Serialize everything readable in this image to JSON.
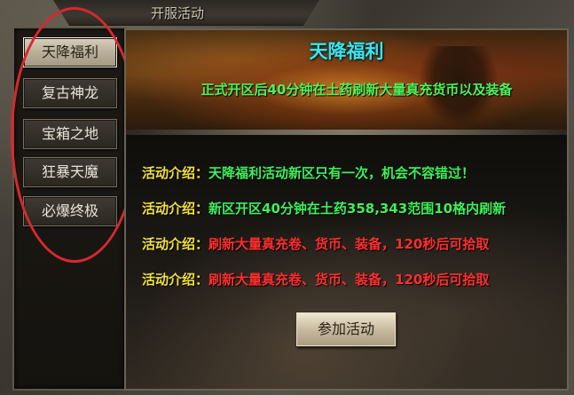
{
  "window": {
    "title": "开服活动"
  },
  "tabs": [
    {
      "label": "天降福利",
      "active": true
    },
    {
      "label": "复古神龙",
      "active": false
    },
    {
      "label": "宝箱之地",
      "active": false
    },
    {
      "label": "狂暴天魔",
      "active": false
    },
    {
      "label": "必爆终极",
      "active": false
    }
  ],
  "banner": {
    "title": "天降福利",
    "subtitle": "正式开区后40分钟在土药刷新大量真充货币以及装备"
  },
  "info": [
    {
      "label": "活动介绍：",
      "text": "天降福利活动新区只有一次，机会不容错过！",
      "color": "green"
    },
    {
      "label": "活动介绍：",
      "text": "新区开区40分钟在土药358,343范围10格内刷新",
      "color": "green"
    },
    {
      "label": "活动介绍：",
      "text": "刷新大量真充卷、货币、装备，120秒后可拾取",
      "color": "red"
    },
    {
      "label": "活动介绍：",
      "text": "刷新大量真充卷、货币、装备，120秒后可拾取",
      "color": "red"
    }
  ],
  "join_button": "参加活动",
  "colors": {
    "title_cyan": "#39e6f0",
    "subtitle_green": "#4df25a",
    "label_yellow": "#f2e23a",
    "text_green": "#3df05a",
    "text_red": "#ff2e2e",
    "annotation_red": "#d8282e"
  }
}
